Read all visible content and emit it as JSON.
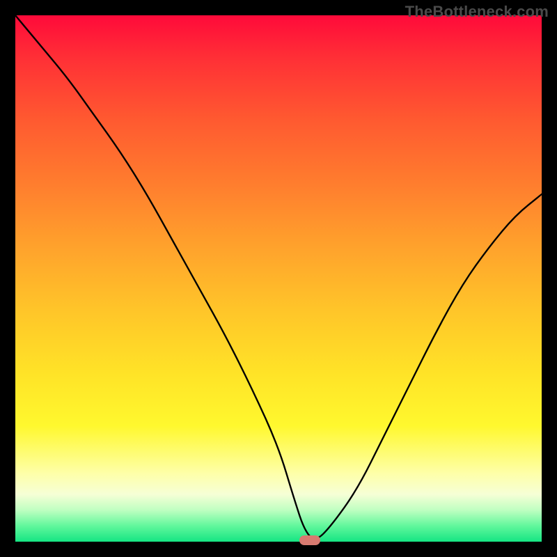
{
  "watermark": "TheBottleneck.com",
  "chart_data": {
    "type": "line",
    "title": "",
    "xlabel": "",
    "ylabel": "",
    "xlim": [
      0,
      100
    ],
    "ylim": [
      0,
      100
    ],
    "grid": false,
    "series": [
      {
        "name": "bottleneck-curve",
        "x": [
          0,
          5,
          10,
          15,
          20,
          25,
          30,
          35,
          40,
          45,
          50,
          53,
          55,
          57,
          60,
          65,
          70,
          75,
          80,
          85,
          90,
          95,
          100
        ],
        "values": [
          100,
          94,
          88,
          81,
          74,
          66,
          57,
          48,
          39,
          29,
          18,
          8,
          2,
          0,
          3,
          10,
          20,
          30,
          40,
          49,
          56,
          62,
          66
        ]
      }
    ],
    "annotations": [
      {
        "name": "min-marker",
        "x": 56,
        "y": 0,
        "shape": "pill",
        "color": "#d87a70"
      }
    ],
    "background_gradient": {
      "direction": "vertical",
      "stops": [
        {
          "pos": 0.0,
          "color": "#ff0a3a"
        },
        {
          "pos": 0.2,
          "color": "#ff5a30"
        },
        {
          "pos": 0.44,
          "color": "#ffa22c"
        },
        {
          "pos": 0.68,
          "color": "#ffe327"
        },
        {
          "pos": 0.87,
          "color": "#feffa8"
        },
        {
          "pos": 0.97,
          "color": "#61f79c"
        },
        {
          "pos": 1.0,
          "color": "#15e583"
        }
      ]
    }
  }
}
